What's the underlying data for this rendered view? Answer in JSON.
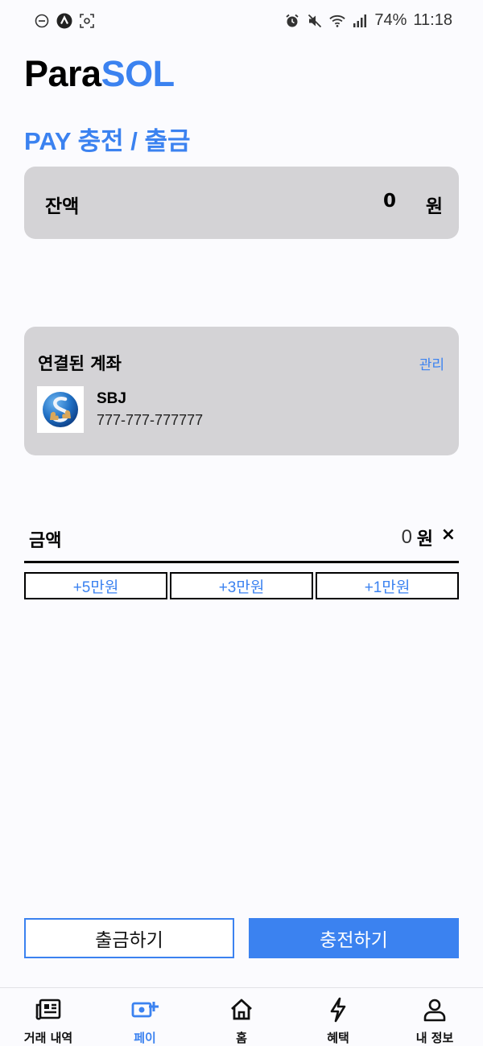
{
  "status_bar": {
    "battery": "74%",
    "time": "11:18",
    "icons": [
      "dnd-icon",
      "nav-app-icon",
      "screenshot-icon",
      "alarm-icon",
      "mute-icon",
      "wifi-icon",
      "signal-icon"
    ]
  },
  "header": {
    "logo_part1": "Para",
    "logo_part2": "SOL",
    "title": "PAY 충전 / 출금"
  },
  "balance": {
    "label": "잔액",
    "value": "0",
    "unit": "원"
  },
  "account": {
    "title": "연결된 계좌",
    "manage_label": "관리",
    "bank_name": "SBJ",
    "account_number": "777-777-777777"
  },
  "amount": {
    "label": "금액",
    "value": "0",
    "unit": "원",
    "clear_label": "×"
  },
  "quick_amounts": [
    "+5만원",
    "+3만원",
    "+1만원"
  ],
  "actions": {
    "withdraw_label": "출금하기",
    "charge_label": "충전하기"
  },
  "nav": {
    "items": [
      {
        "label": "거래 내역",
        "icon": "newspaper-icon"
      },
      {
        "label": "페이",
        "icon": "pay-card-icon"
      },
      {
        "label": "홈",
        "icon": "home-icon"
      },
      {
        "label": "혜택",
        "icon": "bolt-icon"
      },
      {
        "label": "내 정보",
        "icon": "person-icon"
      }
    ],
    "active_index": 1
  },
  "colors": {
    "accent": "#3b82f0",
    "card_bg": "#d4d3d6"
  }
}
